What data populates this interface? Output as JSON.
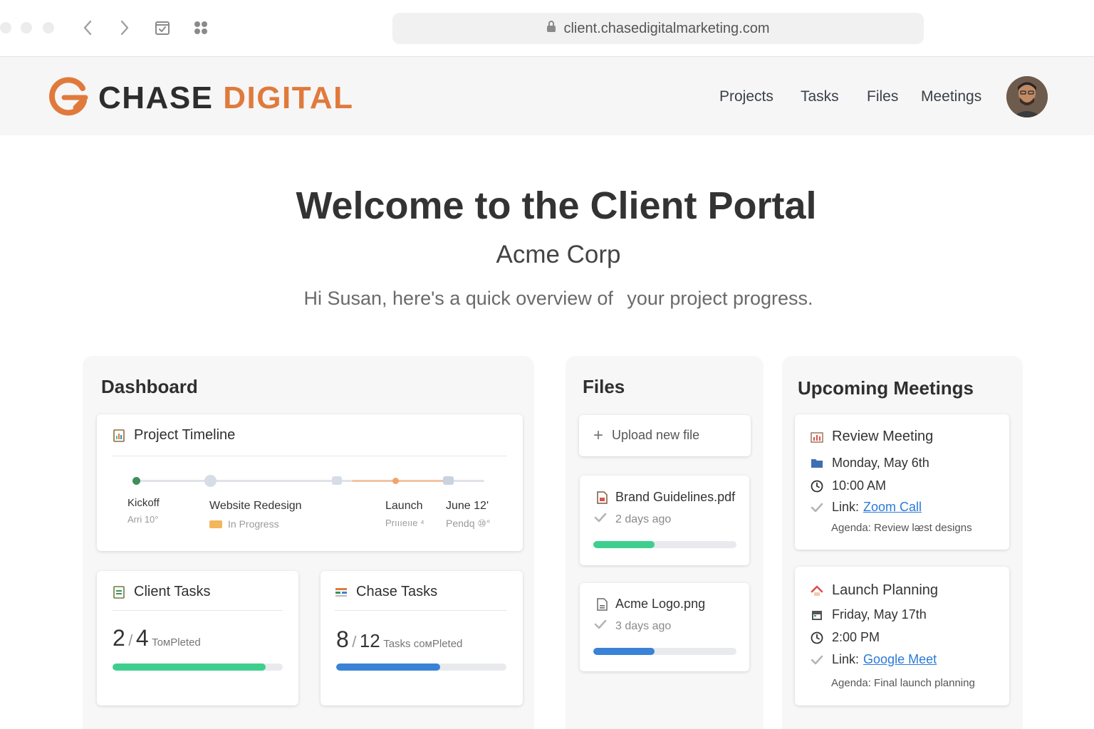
{
  "browser": {
    "url": "client.chasedigitalmarketing.com"
  },
  "header": {
    "logo_dark": "CHASE",
    "logo_accent": "DIGITAL",
    "nav": [
      "Projects",
      "Tasks",
      "Files",
      "Meetings"
    ]
  },
  "hero": {
    "title": "Welcome to the Client Portal",
    "client": "Acme Corp",
    "greeting_a": "Hi Susan, here's a quick overview of",
    "greeting_b": "your project progress."
  },
  "dashboard": {
    "title": "Dashboard",
    "timeline": {
      "title": "Project Timeline",
      "milestones": [
        {
          "label": "Kickoff",
          "sub": "Arri 10°"
        },
        {
          "label": "Website Redesign",
          "sub": "In Progress"
        },
        {
          "label": "Launch",
          "sub": "Prıııeııe ⁴"
        },
        {
          "label": "June 12'",
          "sub": "Pendq ⑩°"
        }
      ]
    },
    "client_tasks": {
      "title": "Client Tasks",
      "done": "2",
      "sep": "/",
      "total": "4",
      "caption": "ToмPleted",
      "progress": 0.9
    },
    "chase_tasks": {
      "title": "Chase Tasks",
      "done": "8",
      "sep": "/",
      "total": "12",
      "caption": "Tasks coмPleted",
      "progress": 0.61
    }
  },
  "files": {
    "title": "Files",
    "upload_label": "Upload new file",
    "items": [
      {
        "name": "Brand Guidelines.pdf",
        "meta": "2 days ago",
        "progress": 0.43,
        "color": "#3ecf8e"
      },
      {
        "name": "Acme Logo.png",
        "meta": "3 days ago",
        "progress": 0.43,
        "color": "#3a82d6"
      }
    ]
  },
  "meetings": {
    "title": "Upcoming Meetings",
    "items": [
      {
        "title": "Review Meeting",
        "date": "Monday, May 6th",
        "time": "10:00 AM",
        "link_prefix": "Link:",
        "link_text": "Zoom Call",
        "agenda": "Agenda: Review lᴂst designs"
      },
      {
        "title": "Launch Planning",
        "date": "Friday, May 17th",
        "time": "2:00 PM",
        "link_prefix": "Link:",
        "link_text": "Google Meet",
        "agenda": "Agenda: Final launch planning"
      }
    ]
  },
  "colors": {
    "accent": "#e07a3c",
    "green": "#3ecf8e",
    "blue": "#3a82d6",
    "link": "#2a7bd6"
  }
}
